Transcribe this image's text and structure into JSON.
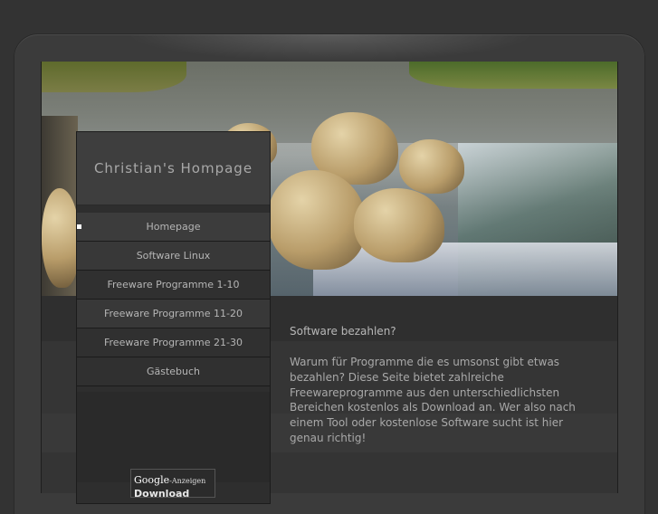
{
  "site": {
    "title": "Christian's Hompage"
  },
  "nav": {
    "items": [
      {
        "label": "Homepage"
      },
      {
        "label": "Software Linux"
      },
      {
        "label": "Freeware Programme 1-10"
      },
      {
        "label": "Freeware Programme 11-20"
      },
      {
        "label": "Freeware Programme 21-30"
      },
      {
        "label": "Gästebuch"
      }
    ]
  },
  "content": {
    "heading": "Software bezahlen?",
    "paragraph": "Warum für Programme die es umsonst gibt etwas bezahlen? Diese Seite bietet zahlreiche Freewareprogramme aus den unterschiedlichsten Bereichen kostenlos als Download an. Wer also nach einem Tool oder kostenlose Software sucht ist hier genau richtig!"
  },
  "ad": {
    "brand": "Google",
    "suffix": "-Anzeigen",
    "link": "Download"
  },
  "colors": {
    "background": "#333333",
    "active_bullet": "#ffffff",
    "text": "#a9a9a9"
  }
}
